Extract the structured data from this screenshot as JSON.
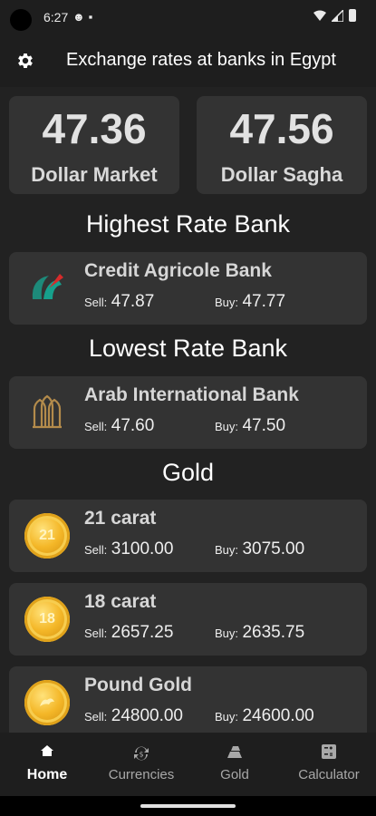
{
  "status_bar": {
    "time": "6:27"
  },
  "app_bar": {
    "title": "Exchange rates at banks in Egypt"
  },
  "top_cards": [
    {
      "value": "47.36",
      "label": "Dollar Market"
    },
    {
      "value": "47.56",
      "label": "Dollar Sagha"
    }
  ],
  "highest": {
    "title": "Highest Rate Bank",
    "bank": "Credit Agricole Bank",
    "sell_label": "Sell:",
    "sell_value": "47.87",
    "buy_label": "Buy:",
    "buy_value": "47.77"
  },
  "lowest": {
    "title": "Lowest Rate Bank",
    "bank": "Arab International Bank",
    "sell_label": "Sell:",
    "sell_value": "47.60",
    "buy_label": "Buy:",
    "buy_value": "47.50"
  },
  "gold": {
    "title": "Gold",
    "items": [
      {
        "name": "21 carat",
        "coin_text": "21",
        "sell_label": "Sell:",
        "sell_value": "3100.00",
        "buy_label": "Buy:",
        "buy_value": "3075.00"
      },
      {
        "name": "18 carat",
        "coin_text": "18",
        "sell_label": "Sell:",
        "sell_value": "2657.25",
        "buy_label": "Buy:",
        "buy_value": "2635.75"
      },
      {
        "name": "Pound Gold",
        "coin_text": "",
        "sell_label": "Sell:",
        "sell_value": "24800.00",
        "buy_label": "Buy:",
        "buy_value": "24600.00"
      }
    ]
  },
  "nav": {
    "items": [
      {
        "label": "Home",
        "icon": "home-icon",
        "active": true
      },
      {
        "label": "Currencies",
        "icon": "currency-exchange-icon",
        "active": false
      },
      {
        "label": "Gold",
        "icon": "gold-bars-icon",
        "active": false
      },
      {
        "label": "Calculator",
        "icon": "calculator-icon",
        "active": false
      }
    ]
  }
}
